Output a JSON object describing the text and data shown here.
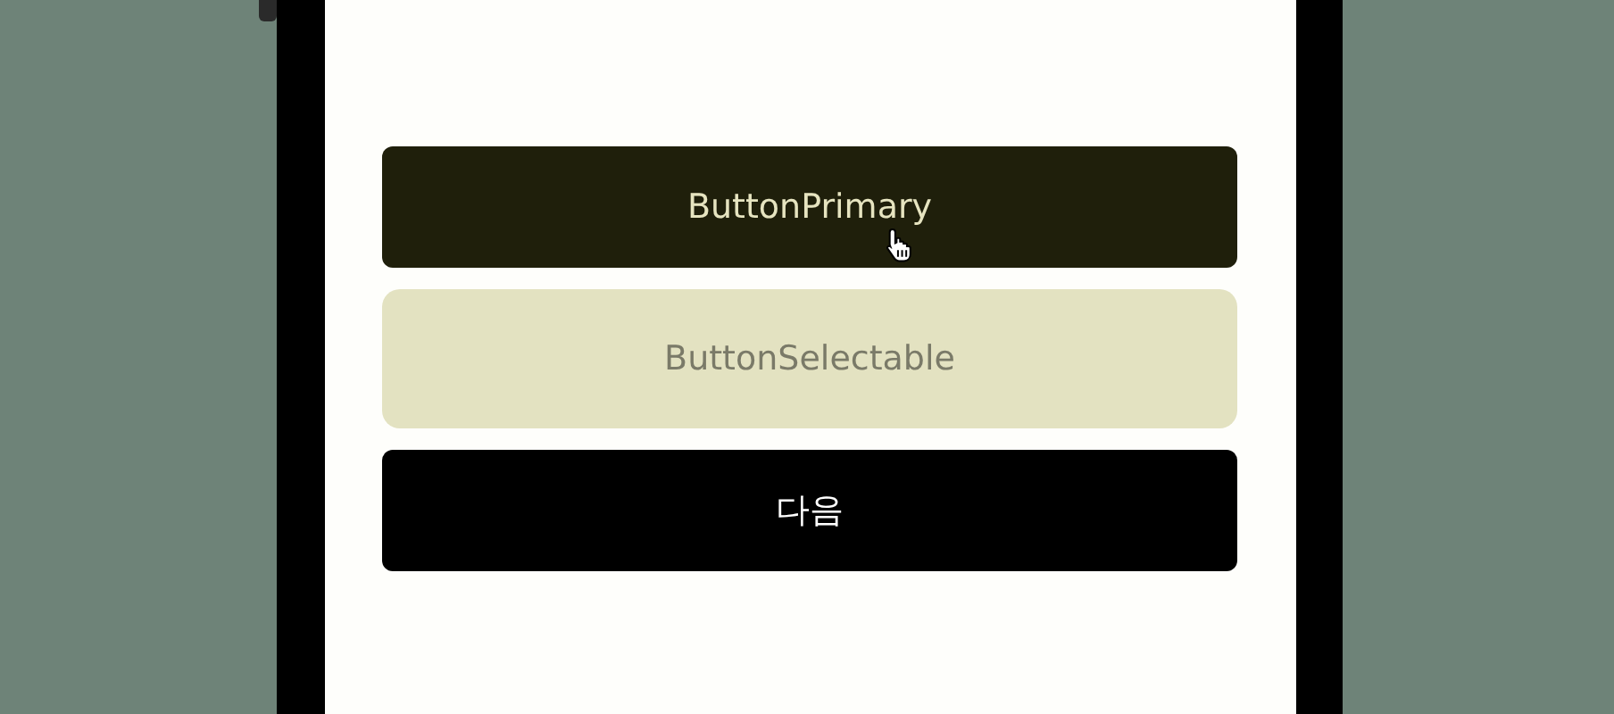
{
  "buttons": [
    {
      "label": "ButtonPrimary",
      "kind": "primary",
      "hovered": true
    },
    {
      "label": "ButtonSelectable",
      "kind": "selectable",
      "hovered": false
    },
    {
      "label": "다음",
      "kind": "next",
      "hovered": false
    }
  ]
}
